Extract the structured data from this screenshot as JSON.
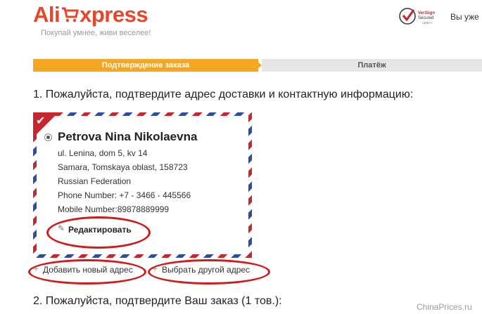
{
  "header": {
    "logo_left": "Ali",
    "logo_right": "xpress",
    "tagline": "Покупай умнее, живи веселее!",
    "login_text": "Вы уже в",
    "verisign_line1": "VeriSign",
    "verisign_line2": "Secured",
    "verisign_line3": "VERIFY"
  },
  "progress": {
    "step1": "Подтверждение заказа",
    "step2": "Платёж"
  },
  "section1_title": "1. Пожалуйста, подтвердите адрес доставки и контактную информацию:",
  "address": {
    "name": "Petrova Nina Nikolaevna",
    "street": "ul. Lenina, dom 5, kv 14",
    "city": "Samara, Tomskaya oblast, 158723",
    "country": "Russian Federation",
    "phone": "Phone Number: +7 - 3466 - 445566",
    "mobile": "Mobile Number:89878889999",
    "edit_label": "Редактировать"
  },
  "actions": {
    "add_label": "Добавить новый адрес",
    "choose_label": "Выбрать другой адрес"
  },
  "section2_title": "2. Пожалуйста, подтвердите Ваш заказ (1 тов.):",
  "watermark": "ChinaPrices.ru",
  "colors": {
    "brand_red": "#e8452b",
    "progress_active": "#f5a623",
    "progress_inactive": "#e6e6e6",
    "annotation_red": "#d11a1a",
    "envelope_blue": "#2f4ea1"
  }
}
